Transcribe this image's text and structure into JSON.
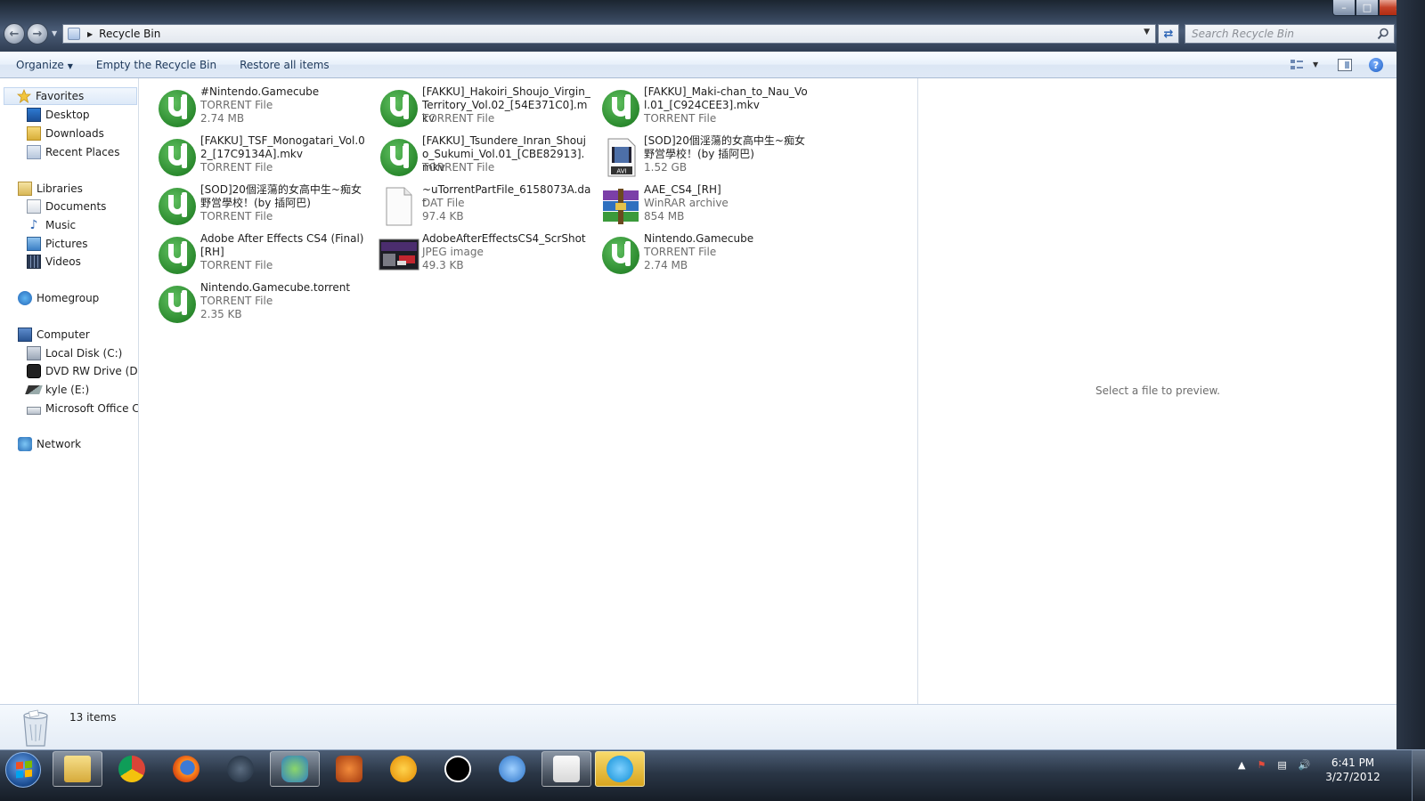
{
  "window": {
    "address_path": "Recycle Bin",
    "search_placeholder": "Search Recycle Bin",
    "controls": {
      "minimize": "–",
      "maximize": "□",
      "close": "✕"
    }
  },
  "command_bar": {
    "organize": "Organize",
    "empty_bin": "Empty the Recycle Bin",
    "restore_all": "Restore all items"
  },
  "navigation": {
    "favorites": {
      "label": "Favorites",
      "items": [
        "Desktop",
        "Downloads",
        "Recent Places"
      ]
    },
    "libraries": {
      "label": "Libraries",
      "items": [
        "Documents",
        "Music",
        "Pictures",
        "Videos"
      ]
    },
    "homegroup": "Homegroup",
    "computer": {
      "label": "Computer",
      "items": [
        "Local Disk (C:)",
        "DVD RW Drive (D:) E",
        "kyle (E:)",
        "Microsoft Office Clic"
      ]
    },
    "network": "Network"
  },
  "files": [
    {
      "name": "#Nintendo.Gamecube",
      "type": "TORRENT File",
      "size": "2.74 MB",
      "icon": "utorrent-icon"
    },
    {
      "name": "[FAKKU]_Hakoiri_Shoujo_Virgin_Territory_Vol.02_[54E371C0].mkv",
      "type": "TORRENT File",
      "size": "",
      "icon": "utorrent-icon"
    },
    {
      "name": "[FAKKU]_Maki-chan_to_Nau_Vol.01_[C924CEE3].mkv",
      "type": "TORRENT File",
      "size": "",
      "icon": "utorrent-icon"
    },
    {
      "name": "[FAKKU]_TSF_Monogatari_Vol.02_[17C9134A].mkv",
      "type": "TORRENT File",
      "size": "",
      "icon": "utorrent-icon"
    },
    {
      "name": "[FAKKU]_Tsundere_Inran_Shoujo_Sukumi_Vol.01_[CBE82913].mkv",
      "type": "TORRENT File",
      "size": "",
      "icon": "utorrent-icon"
    },
    {
      "name": "[SOD]20個淫蕩的女高中生~痴女野営學校！(by 插阿巴)",
      "type": "",
      "size": "1.52 GB",
      "icon": "avi-icon"
    },
    {
      "name": "[SOD]20個淫蕩的女高中生~痴女野営學校！(by 插阿巴)",
      "type": "TORRENT File",
      "size": "",
      "icon": "utorrent-icon"
    },
    {
      "name": "~uTorrentPartFile_6158073A.dat",
      "type": "DAT File",
      "size": "97.4 KB",
      "icon": "blank-file-icon"
    },
    {
      "name": "AAE_CS4_[RH]",
      "type": "WinRAR archive",
      "size": "854 MB",
      "icon": "winrar-icon"
    },
    {
      "name": "Adobe After Effects CS4 (Final) [RH]",
      "type": "TORRENT File",
      "size": "",
      "icon": "utorrent-icon"
    },
    {
      "name": "AdobeAfterEffectsCS4_ScrShot",
      "type": "JPEG image",
      "size": "49.3 KB",
      "icon": "jpeg-thumbnail-icon"
    },
    {
      "name": "Nintendo.Gamecube",
      "type": "TORRENT File",
      "size": "2.74 MB",
      "icon": "utorrent-icon"
    },
    {
      "name": "Nintendo.Gamecube.torrent",
      "type": "TORRENT File",
      "size": "2.35 KB",
      "icon": "utorrent-icon"
    }
  ],
  "preview": {
    "message": "Select a file to preview."
  },
  "details": {
    "count": "13 items"
  },
  "taskbar": {
    "apps": [
      "windows-explorer-icon",
      "chrome-icon",
      "firefox-icon",
      "steam-icon",
      "messenger-icon",
      "reason-icon",
      "fl-studio-icon",
      "ableton-live-icon",
      "itunes-icon",
      "java-icon",
      "skype-icon"
    ],
    "clock_time": "6:41 PM",
    "clock_date": "3/27/2012"
  },
  "colors": {
    "accent": "#1e395b",
    "utorrent_green": "#2b8a2e",
    "meta_gray": "#6d6d6d"
  }
}
